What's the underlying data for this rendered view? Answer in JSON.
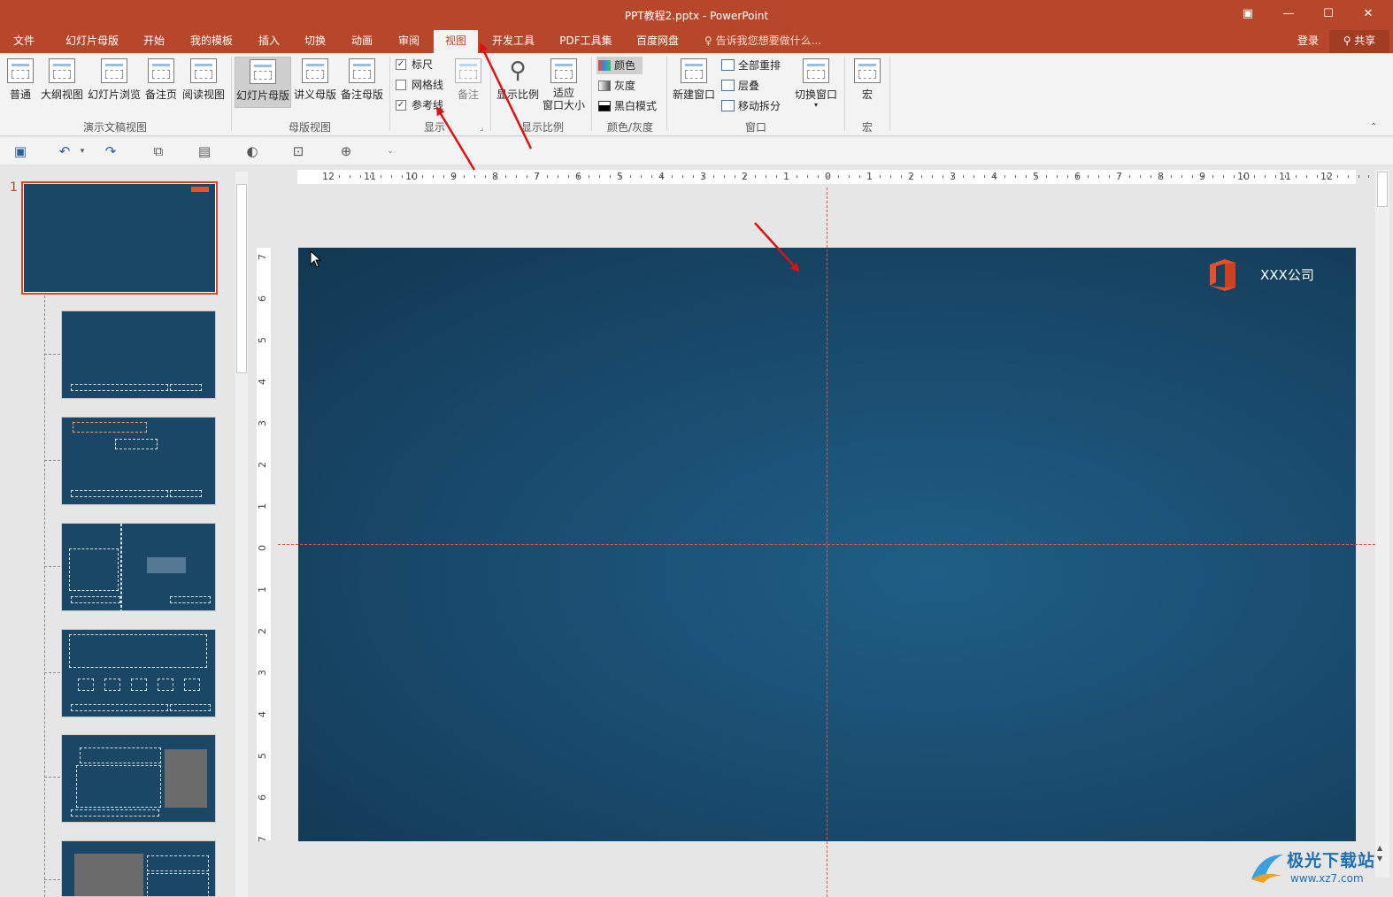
{
  "window": {
    "title": "PPT教程2.pptx - PowerPoint",
    "restore_icon": "ribbon-display-icon",
    "min_label": "—",
    "max_label": "☐",
    "close_label": "✕"
  },
  "tabs": [
    "文件",
    "幻灯片母版",
    "开始",
    "我的模板",
    "插入",
    "切换",
    "动画",
    "审阅",
    "视图",
    "开发工具",
    "PDF工具集",
    "百度网盘"
  ],
  "active_tab": "视图",
  "tell_me": "告诉我您想要做什么...",
  "login": "登录",
  "share": "共享",
  "ribbon": {
    "presentation_views": {
      "label": "演示文稿视图",
      "buttons": [
        "普通",
        "大纲视图",
        "幻灯片浏览",
        "备注页",
        "阅读视图"
      ]
    },
    "master_views": {
      "label": "母版视图",
      "buttons": [
        "幻灯片母版",
        "讲义母版",
        "备注母版"
      ]
    },
    "show": {
      "label": "显示",
      "ruler": "标尺",
      "ruler_checked": true,
      "gridlines": "网格线",
      "gridlines_checked": false,
      "guides": "参考线",
      "guides_checked": true,
      "notes": "备注"
    },
    "zoom": {
      "label": "显示比例",
      "zoom": "显示比例",
      "fit_line1": "适应",
      "fit_line2": "窗口大小"
    },
    "color": {
      "label": "颜色/灰度",
      "color": "颜色",
      "grayscale": "灰度",
      "bw": "黑白模式"
    },
    "window_group": {
      "label": "窗口",
      "new_window": "新建窗口",
      "arrange_all": "全部重排",
      "cascade": "层叠",
      "move_split": "移动拆分",
      "switch_windows": "切换窗口"
    },
    "macros": {
      "label": "宏",
      "macros": "宏"
    }
  },
  "thumbnails": {
    "selected_number": "1"
  },
  "slide": {
    "company": "XXX公司"
  },
  "ruler": {
    "horizontal": [
      "12",
      "11",
      "10",
      "9",
      "8",
      "7",
      "6",
      "5",
      "4",
      "3",
      "2",
      "1",
      "0",
      "1",
      "2",
      "3",
      "4",
      "5",
      "6",
      "7",
      "8",
      "9",
      "10",
      "11",
      "12"
    ],
    "vertical": [
      "7",
      "6",
      "5",
      "4",
      "3",
      "2",
      "1",
      "0",
      "1",
      "2",
      "3",
      "4",
      "5",
      "6",
      "7"
    ]
  },
  "watermark": {
    "main": "极光下载站",
    "sub": "www.xz7.com"
  },
  "colors": {
    "brand": "#b7472a",
    "slide_bg": "#1a4d70",
    "guide": "#e05a4a",
    "arrow": "#e01010"
  }
}
